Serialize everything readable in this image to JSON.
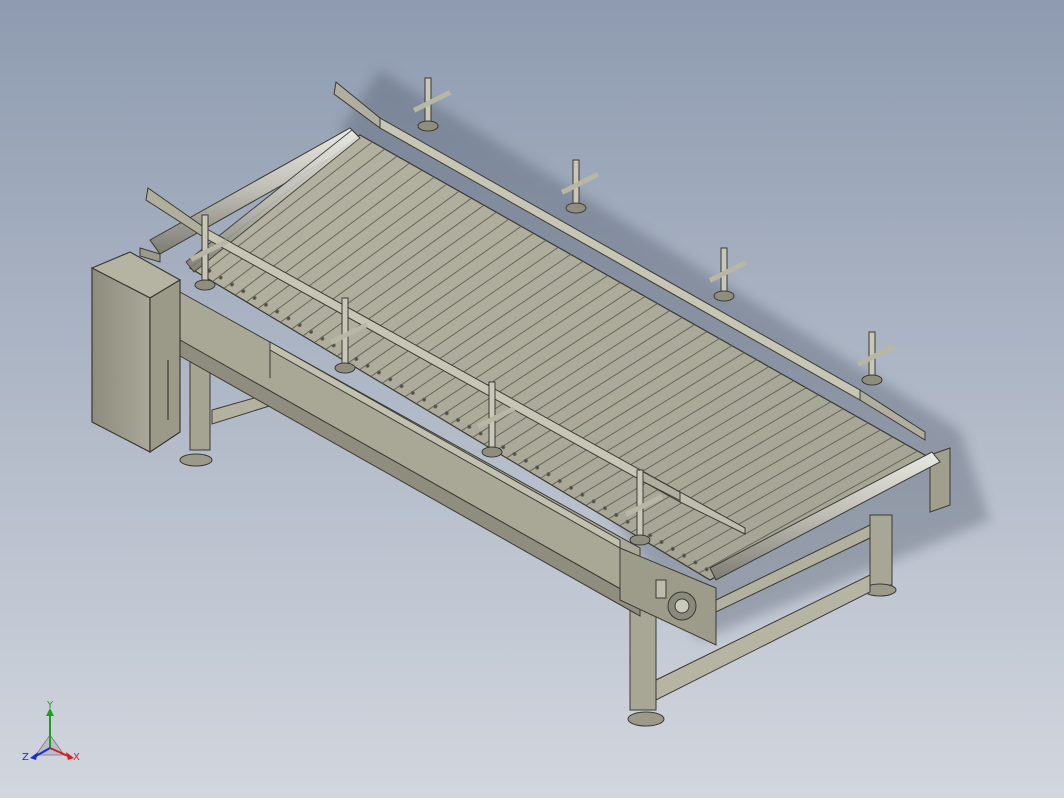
{
  "triad": {
    "x_label": "X",
    "y_label": "Y",
    "z_label": "Z",
    "x_color": "#d42020",
    "y_color": "#1ca01c",
    "z_color": "#1a2bd8"
  },
  "colors": {
    "bg_top": "#8e9bb0",
    "bg_bottom": "#cfd4dc",
    "metal_light": "#b9b8a6",
    "metal_mid": "#9f9e8c",
    "metal_dark": "#6f6e60",
    "edge": "#3a3a34"
  }
}
